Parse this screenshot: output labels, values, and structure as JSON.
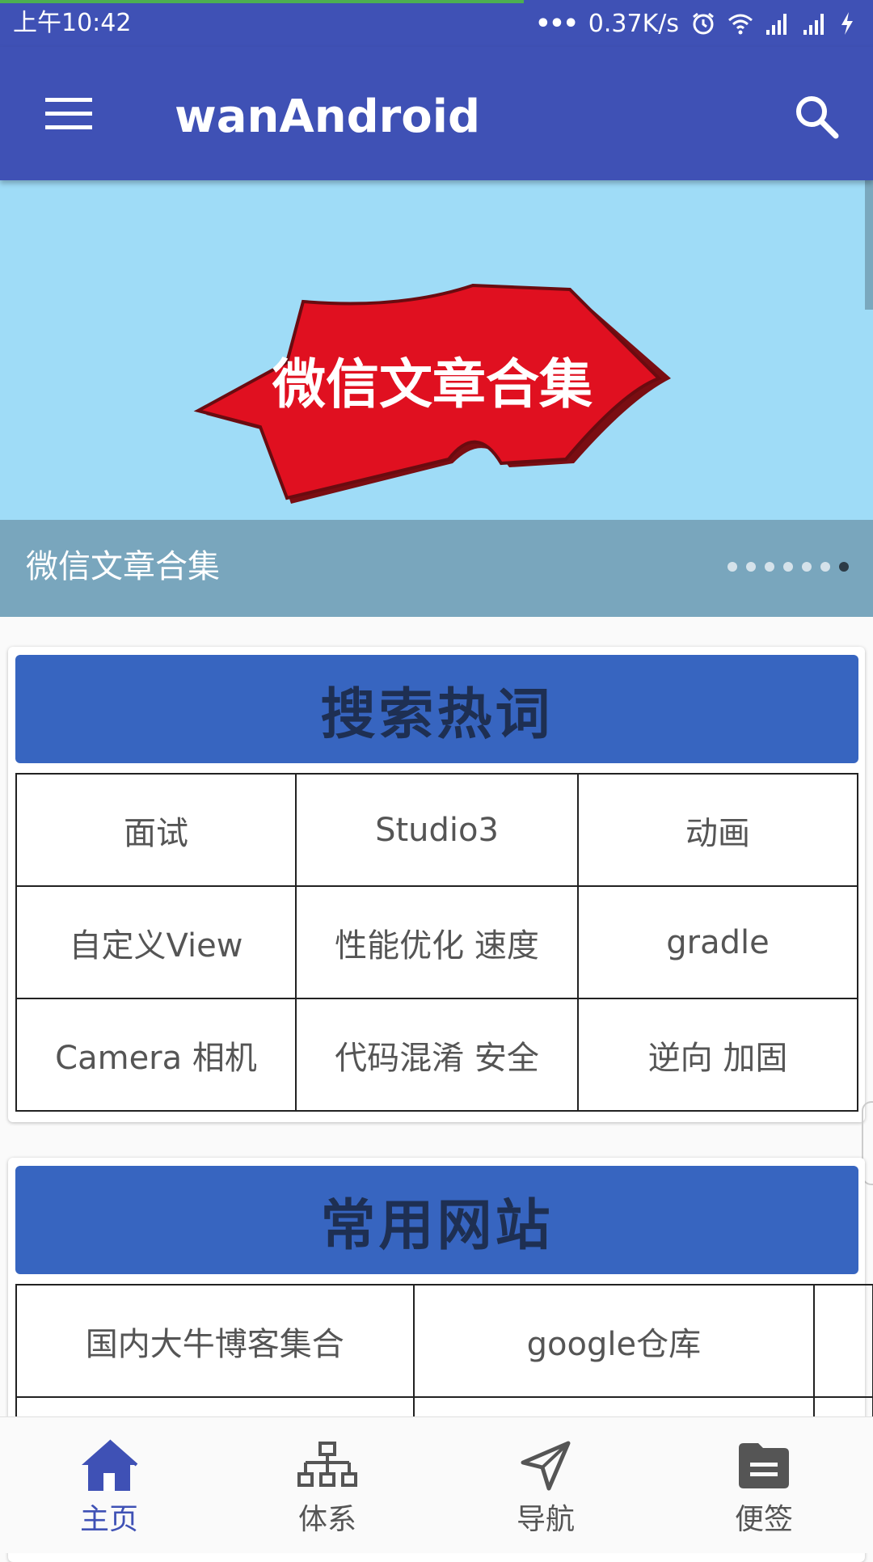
{
  "status_bar": {
    "time": "上午10:42",
    "more": "•••",
    "net_speed": "0.37K/s",
    "icons": [
      "alarm-icon",
      "wifi-icon",
      "signal-icon",
      "signal-icon",
      "charging-icon"
    ],
    "page_load_progress": 0.6
  },
  "app_bar": {
    "title": "wanAndroid",
    "menu_icon": "menu-icon",
    "search_icon": "search-icon",
    "color": "#3f51b5"
  },
  "banner": {
    "image_text": "微信文章合集",
    "caption": "微信文章合集",
    "dot_count": 7,
    "active_dot": 7
  },
  "hot_words": {
    "title": "搜索热词",
    "rows": [
      [
        "面试",
        "Studio3",
        "动画"
      ],
      [
        "自定义View",
        "性能优化 速度",
        "gradle"
      ],
      [
        "Camera 相机",
        "代码混淆 安全",
        "逆向 加固"
      ]
    ]
  },
  "common_sites": {
    "title": "常用网站",
    "rows": [
      [
        "国内大牛博客集合",
        "google仓库",
        ""
      ],
      [
        "",
        "",
        ""
      ]
    ]
  },
  "bottom_nav": {
    "items": [
      {
        "label": "主页",
        "icon": "home-icon",
        "active": true
      },
      {
        "label": "体系",
        "icon": "hierarchy-icon",
        "active": false
      },
      {
        "label": "导航",
        "icon": "navigation-icon",
        "active": false
      },
      {
        "label": "便签",
        "icon": "notes-icon",
        "active": false
      }
    ],
    "active_color": "#3f51b5",
    "inactive_color": "#555555"
  }
}
